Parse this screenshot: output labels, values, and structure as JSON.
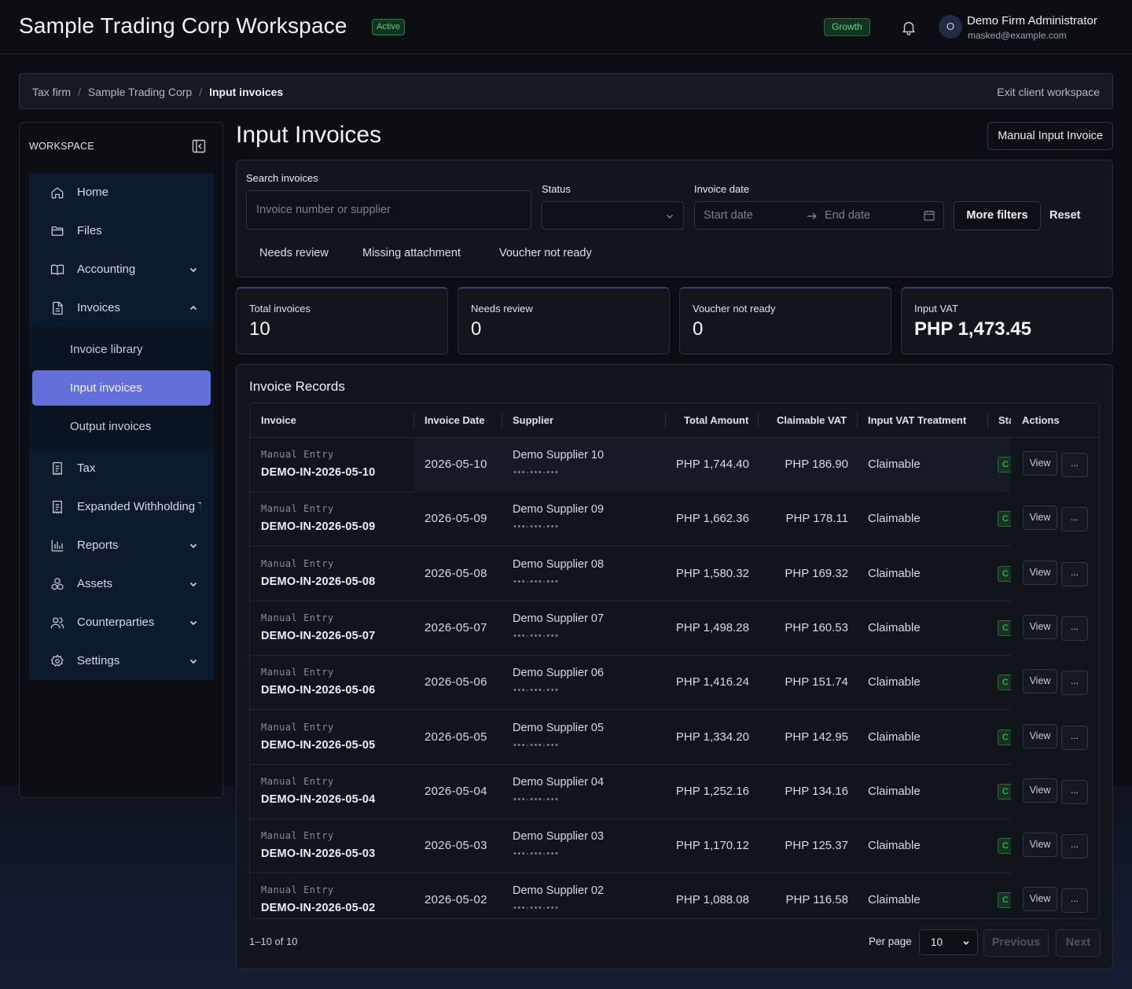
{
  "header": {
    "title": "Sample Trading Corp Workspace",
    "status_badge": "Active",
    "plan_badge": "Growth",
    "user": {
      "initial": "O",
      "name": "Demo Firm Administrator",
      "email": "masked@example.com"
    }
  },
  "breadcrumb": {
    "items": [
      "Tax firm",
      "Sample Trading Corp",
      "Input invoices"
    ],
    "exit_label": "Exit client workspace"
  },
  "sidebar": {
    "heading": "WORKSPACE",
    "items": [
      {
        "label": "Home",
        "icon": "home-icon"
      },
      {
        "label": "Files",
        "icon": "folder-icon"
      },
      {
        "label": "Accounting",
        "icon": "book-icon",
        "expandable": true
      },
      {
        "label": "Invoices",
        "icon": "document-icon",
        "expanded": true
      },
      {
        "label": "Tax",
        "icon": "receipt-icon"
      },
      {
        "label": "Expanded Withholding Tax",
        "icon": "receipt-icon"
      },
      {
        "label": "Reports",
        "icon": "bar-chart-icon",
        "expandable": true
      },
      {
        "label": "Assets",
        "icon": "cubes-icon",
        "expandable": true
      },
      {
        "label": "Counterparties",
        "icon": "users-icon",
        "expandable": true
      },
      {
        "label": "Settings",
        "icon": "gear-icon",
        "expandable": true
      }
    ],
    "invoice_subitems": [
      "Invoice library",
      "Input invoices",
      "Output invoices"
    ],
    "active_subitem": "Input invoices"
  },
  "page": {
    "title": "Input Invoices",
    "primary_button": "Manual Input Invoice"
  },
  "filters": {
    "search_label": "Search invoices",
    "search_placeholder": "Invoice number or supplier",
    "status_label": "Status",
    "status_value": "",
    "date_label": "Invoice date",
    "start_placeholder": "Start date",
    "end_placeholder": "End date",
    "more_filters": "More filters",
    "reset": "Reset",
    "quick_filters": [
      "Needs review",
      "Missing attachment",
      "Voucher not ready"
    ]
  },
  "stats": [
    {
      "label": "Total invoices",
      "value": "10"
    },
    {
      "label": "Needs review",
      "value": "0"
    },
    {
      "label": "Voucher not ready",
      "value": "0"
    },
    {
      "label": "Input VAT",
      "value": "PHP 1,473.45"
    }
  ],
  "records": {
    "title": "Invoice Records",
    "columns": [
      "Invoice",
      "Invoice Date",
      "Supplier",
      "Total Amount",
      "Claimable VAT",
      "Input VAT Treatment",
      "Status",
      "Actions"
    ],
    "status_header_visible": "Sta",
    "status_cell_visible": "C",
    "view_label": "View",
    "more_label": "...",
    "rows": [
      {
        "source": "Manual Entry",
        "invoice": "DEMO-IN-2026-05-10",
        "date": "2026-05-10",
        "supplier": "Demo Supplier 10",
        "tin": "•••-•••-•••",
        "total": "PHP 1,744.40",
        "vat": "PHP 186.90",
        "treatment": "Claimable"
      },
      {
        "source": "Manual Entry",
        "invoice": "DEMO-IN-2026-05-09",
        "date": "2026-05-09",
        "supplier": "Demo Supplier 09",
        "tin": "•••-•••-•••",
        "total": "PHP 1,662.36",
        "vat": "PHP 178.11",
        "treatment": "Claimable"
      },
      {
        "source": "Manual Entry",
        "invoice": "DEMO-IN-2026-05-08",
        "date": "2026-05-08",
        "supplier": "Demo Supplier 08",
        "tin": "•••-•••-•••",
        "total": "PHP 1,580.32",
        "vat": "PHP 169.32",
        "treatment": "Claimable"
      },
      {
        "source": "Manual Entry",
        "invoice": "DEMO-IN-2026-05-07",
        "date": "2026-05-07",
        "supplier": "Demo Supplier 07",
        "tin": "•••-•••-•••",
        "total": "PHP 1,498.28",
        "vat": "PHP 160.53",
        "treatment": "Claimable"
      },
      {
        "source": "Manual Entry",
        "invoice": "DEMO-IN-2026-05-06",
        "date": "2026-05-06",
        "supplier": "Demo Supplier 06",
        "tin": "•••-•••-•••",
        "total": "PHP 1,416.24",
        "vat": "PHP 151.74",
        "treatment": "Claimable"
      },
      {
        "source": "Manual Entry",
        "invoice": "DEMO-IN-2026-05-05",
        "date": "2026-05-05",
        "supplier": "Demo Supplier 05",
        "tin": "•••-•••-•••",
        "total": "PHP 1,334.20",
        "vat": "PHP 142.95",
        "treatment": "Claimable"
      },
      {
        "source": "Manual Entry",
        "invoice": "DEMO-IN-2026-05-04",
        "date": "2026-05-04",
        "supplier": "Demo Supplier 04",
        "tin": "•••-•••-•••",
        "total": "PHP 1,252.16",
        "vat": "PHP 134.16",
        "treatment": "Claimable"
      },
      {
        "source": "Manual Entry",
        "invoice": "DEMO-IN-2026-05-03",
        "date": "2026-05-03",
        "supplier": "Demo Supplier 03",
        "tin": "•••-•••-•••",
        "total": "PHP 1,170.12",
        "vat": "PHP 125.37",
        "treatment": "Claimable"
      },
      {
        "source": "Manual Entry",
        "invoice": "DEMO-IN-2026-05-02",
        "date": "2026-05-02",
        "supplier": "Demo Supplier 02",
        "tin": "•••-•••-•••",
        "total": "PHP 1,088.08",
        "vat": "PHP 116.58",
        "treatment": "Claimable"
      }
    ],
    "range_text": "1–10 of 10",
    "per_page_label": "Per page",
    "per_page_value": "10",
    "previous": "Previous",
    "next": "Next"
  },
  "colors": {
    "accent": "#6470da",
    "active_green": "#4cd07a",
    "nav_bg": "#0b1a2d"
  }
}
